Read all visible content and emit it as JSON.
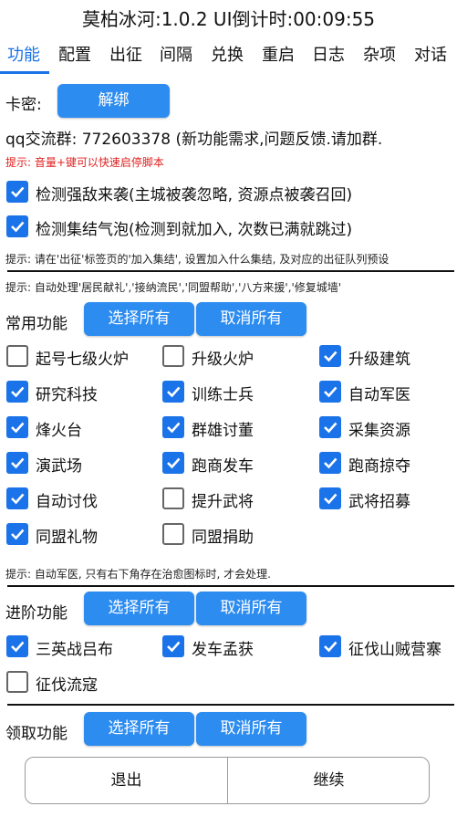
{
  "header": {
    "title": "莫柏冰河:1.0.2  UI倒计时:00:09:55"
  },
  "tabs": [
    "功能",
    "配置",
    "出征",
    "间隔",
    "兑换",
    "重启",
    "日志",
    "杂项",
    "对话"
  ],
  "colors": {
    "accent": "#1a73e8",
    "button": "#2d8cf0",
    "warning": "#e02020"
  },
  "card": {
    "label": "卡密:",
    "unbind_button": "解绑"
  },
  "qq": {
    "text": "qq交流群: 772603378  (新功能需求,问题反馈.请加群."
  },
  "hint_volume": "提示: 音量+键可以快速启停脚本",
  "detect": [
    {
      "label": "检测强敌来袭(主城被袭忽略, 资源点被袭召回)",
      "checked": true
    },
    {
      "label": "检测集结气泡(检测到就加入, 次数已满就跳过)",
      "checked": true
    }
  ],
  "hint_rally": "提示: 请在'出征'标签页的'加入集结', 设置加入什么集结, 及对应的出征队列预设",
  "hint_auto": "提示: 自动处理'居民献礼','接纳流民','同盟帮助','八方来援','修复城墙'",
  "common": {
    "title": "常用功能",
    "select_all": "选择所有",
    "deselect_all": "取消所有",
    "items": [
      {
        "label": "起号七级火炉",
        "checked": false
      },
      {
        "label": "升级火炉",
        "checked": false
      },
      {
        "label": "升级建筑",
        "checked": true
      },
      {
        "label": "研究科技",
        "checked": true
      },
      {
        "label": "训练士兵",
        "checked": true
      },
      {
        "label": "自动军医",
        "checked": true
      },
      {
        "label": "烽火台",
        "checked": true
      },
      {
        "label": "群雄讨董",
        "checked": true
      },
      {
        "label": "采集资源",
        "checked": true
      },
      {
        "label": "演武场",
        "checked": true
      },
      {
        "label": "跑商发车",
        "checked": true
      },
      {
        "label": "跑商掠夺",
        "checked": true
      },
      {
        "label": "自动讨伐",
        "checked": true
      },
      {
        "label": "提升武将",
        "checked": false
      },
      {
        "label": "武将招募",
        "checked": true
      },
      {
        "label": "同盟礼物",
        "checked": true
      },
      {
        "label": "同盟捐助",
        "checked": false
      }
    ]
  },
  "hint_medic": "提示: 自动军医, 只有右下角存在治愈图标时, 才会处理.",
  "advanced": {
    "title": "进阶功能",
    "select_all": "选择所有",
    "deselect_all": "取消所有",
    "items": [
      {
        "label": "三英战吕布",
        "checked": true
      },
      {
        "label": "发车孟获",
        "checked": true
      },
      {
        "label": "征伐山贼营寨",
        "checked": true
      },
      {
        "label": "征伐流寇",
        "checked": false
      }
    ]
  },
  "collect": {
    "title": "领取功能",
    "select_all": "选择所有",
    "deselect_all": "取消所有"
  },
  "footer": {
    "exit": "退出",
    "continue": "继续"
  }
}
